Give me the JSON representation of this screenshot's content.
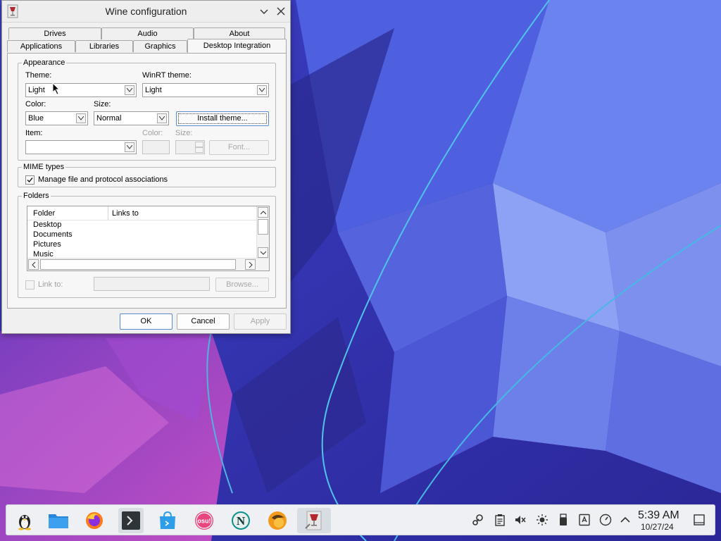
{
  "window": {
    "title": "Wine configuration",
    "tabs_row1": [
      "Drives",
      "Audio",
      "About"
    ],
    "tabs_row2": [
      "Applications",
      "Libraries",
      "Graphics",
      "Desktop Integration"
    ],
    "active_tab": "Desktop Integration"
  },
  "appearance": {
    "legend": "Appearance",
    "theme_label": "Theme:",
    "theme_value": "Light",
    "winrt_label": "WinRT theme:",
    "winrt_value": "Light",
    "color_label": "Color:",
    "color_value": "Blue",
    "size_label": "Size:",
    "size_value": "Normal",
    "install_button": "Install theme...",
    "item_label": "Item:",
    "item_value": "",
    "item_color_label": "Color:",
    "item_size_label": "Size:",
    "font_button": "Font..."
  },
  "mime": {
    "legend": "MIME types",
    "manage_label": "Manage file and protocol associations",
    "manage_checked": true
  },
  "folders": {
    "legend": "Folders",
    "columns": [
      "Folder",
      "Links to"
    ],
    "rows": [
      "Desktop",
      "Documents",
      "Pictures",
      "Music"
    ],
    "link_to_label": "Link to:",
    "browse_button": "Browse..."
  },
  "dialog_buttons": {
    "ok": "OK",
    "cancel": "Cancel",
    "apply": "Apply"
  },
  "taskbar": {
    "apps": [
      "tux-icon",
      "file-manager-icon",
      "firefox-icon",
      "terminal-icon",
      "discover-store-icon",
      "osu-icon",
      "netscape-icon",
      "wine-app-icon",
      "wine-config-icon"
    ],
    "osu_text": "osu!",
    "netscape_text": "N",
    "tray": [
      "steam-icon",
      "clipboard-icon",
      "volume-muted-icon",
      "brightness-icon",
      "usb-drive-icon",
      "accessibility-icon",
      "performance-icon",
      "tray-expand-icon"
    ],
    "clock_time": "5:39 AM",
    "clock_date": "10/27/24",
    "show_desktop": "show-desktop-icon"
  },
  "colors": {
    "accent": "#5a8ad0",
    "wallpaper_dark": "#2e2a9e",
    "wallpaper_mid": "#4a4fd0",
    "wallpaper_magenta": "#b04fc8"
  }
}
